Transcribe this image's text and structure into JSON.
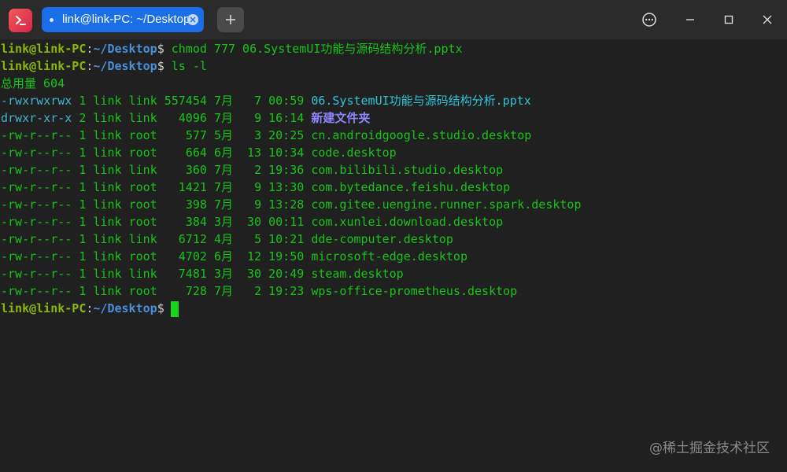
{
  "tab": {
    "title": "link@link-PC: ~/Desktop"
  },
  "prompt": {
    "user": "link@link-PC",
    "colon": ":",
    "path": "~/Desktop",
    "dollar": "$"
  },
  "commands": [
    {
      "text": "chmod 777 06.SystemUI功能与源码结构分析.pptx"
    },
    {
      "text": "ls -l"
    }
  ],
  "total_line": "总用量 604",
  "listing": [
    {
      "perm": "-rwxrwxrwx",
      "links": "1",
      "owner": "link",
      "group": "link",
      "size": "557454",
      "month": "7月",
      "day": "7",
      "time": "00:59",
      "name": "06.SystemUI功能与源码结构分析.pptx",
      "kind": "exec"
    },
    {
      "perm": "drwxr-xr-x",
      "links": "2",
      "owner": "link",
      "group": "link",
      "size": "4096",
      "month": "7月",
      "day": "9",
      "time": "16:14",
      "name": "新建文件夹",
      "kind": "dir"
    },
    {
      "perm": "-rw-r--r--",
      "links": "1",
      "owner": "link",
      "group": "root",
      "size": "577",
      "month": "5月",
      "day": "3",
      "time": "20:25",
      "name": "cn.androidgoogle.studio.desktop",
      "kind": "file"
    },
    {
      "perm": "-rw-r--r--",
      "links": "1",
      "owner": "link",
      "group": "root",
      "size": "664",
      "month": "6月",
      "day": "13",
      "time": "10:34",
      "name": "code.desktop",
      "kind": "file"
    },
    {
      "perm": "-rw-r--r--",
      "links": "1",
      "owner": "link",
      "group": "link",
      "size": "360",
      "month": "7月",
      "day": "2",
      "time": "19:36",
      "name": "com.bilibili.studio.desktop",
      "kind": "file"
    },
    {
      "perm": "-rw-r--r--",
      "links": "1",
      "owner": "link",
      "group": "root",
      "size": "1421",
      "month": "7月",
      "day": "9",
      "time": "13:30",
      "name": "com.bytedance.feishu.desktop",
      "kind": "file"
    },
    {
      "perm": "-rw-r--r--",
      "links": "1",
      "owner": "link",
      "group": "root",
      "size": "398",
      "month": "7月",
      "day": "9",
      "time": "13:28",
      "name": "com.gitee.uengine.runner.spark.desktop",
      "kind": "file"
    },
    {
      "perm": "-rw-r--r--",
      "links": "1",
      "owner": "link",
      "group": "root",
      "size": "384",
      "month": "3月",
      "day": "30",
      "time": "00:11",
      "name": "com.xunlei.download.desktop",
      "kind": "file"
    },
    {
      "perm": "-rw-r--r--",
      "links": "1",
      "owner": "link",
      "group": "link",
      "size": "6712",
      "month": "4月",
      "day": "5",
      "time": "10:21",
      "name": "dde-computer.desktop",
      "kind": "file"
    },
    {
      "perm": "-rw-r--r--",
      "links": "1",
      "owner": "link",
      "group": "root",
      "size": "4702",
      "month": "6月",
      "day": "12",
      "time": "19:50",
      "name": "microsoft-edge.desktop",
      "kind": "file"
    },
    {
      "perm": "-rw-r--r--",
      "links": "1",
      "owner": "link",
      "group": "link",
      "size": "7481",
      "month": "3月",
      "day": "30",
      "time": "20:49",
      "name": "steam.desktop",
      "kind": "file"
    },
    {
      "perm": "-rw-r--r--",
      "links": "1",
      "owner": "link",
      "group": "root",
      "size": "728",
      "month": "7月",
      "day": "2",
      "time": "19:23",
      "name": "wps-office-prometheus.desktop",
      "kind": "file"
    }
  ],
  "colors": {
    "tab_active": "#1a6fe8",
    "prompt_user": "#8ab60a",
    "prompt_path": "#4a90d9",
    "command": "#18c418",
    "exec_file": "#2ec4d6",
    "directory": "#8d86ff",
    "cursor": "#19d419"
  },
  "icons": {
    "app": "terminal-icon",
    "tab_close": "close-icon",
    "new_tab": "plus-icon",
    "menu": "more-options-icon",
    "minimize": "minimize-icon",
    "maximize": "maximize-icon",
    "close": "close-window-icon"
  },
  "watermark": "@稀土掘金技术社区"
}
